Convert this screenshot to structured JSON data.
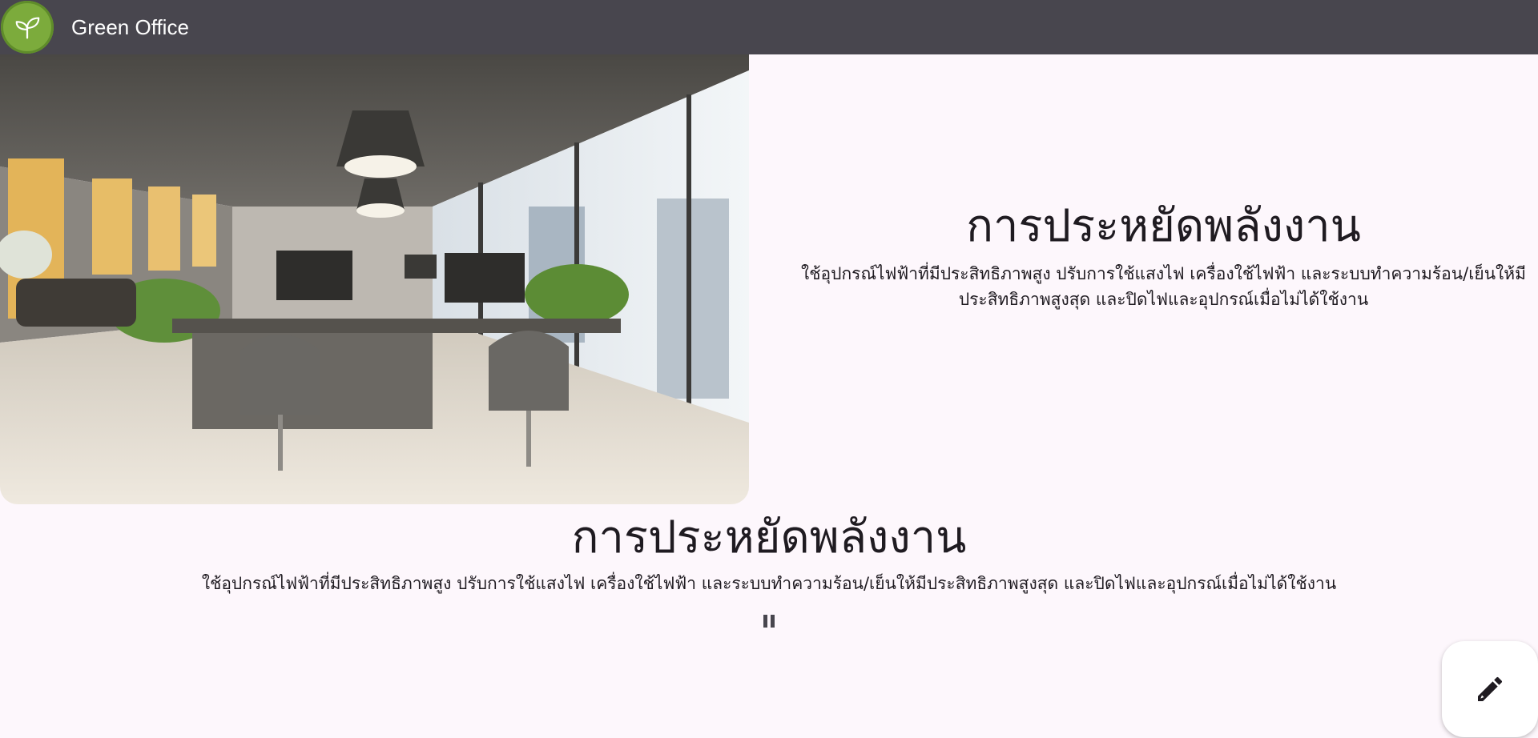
{
  "app": {
    "title": "Green Office",
    "logo_icon": "sprout-icon",
    "colors": {
      "topbar": "#48464e",
      "logo": "#7cab3c",
      "background": "#fdf7fc"
    }
  },
  "hero": {
    "image_subject": "modern open-plan office with desks, chairs, plants and large windows",
    "side_title": "การประหยัดพลังงาน",
    "side_description": "ใช้อุปกรณ์ไฟฟ้าที่มีประสิทธิภาพสูง ปรับการใช้แสงไฟ เครื่องใช้ไฟฟ้า และระบบทำความร้อน/เย็นให้มีประสิทธิภาพสูงสุด และปิดไฟและอุปกรณ์เมื่อไม่ได้ใช้งาน"
  },
  "carousel": {
    "title": "การประหยัดพลังงาน",
    "description": "ใช้อุปกรณ์ไฟฟ้าที่มีประสิทธิภาพสูง ปรับการใช้แสงไฟ เครื่องใช้ไฟฟ้า และระบบทำความร้อน/เย็นให้มีประสิทธิภาพสูงสุด และปิดไฟและอุปกรณ์เมื่อไม่ได้ใช้งาน",
    "pause_icon": "pause-icon"
  },
  "fab": {
    "icon": "pencil-icon"
  }
}
